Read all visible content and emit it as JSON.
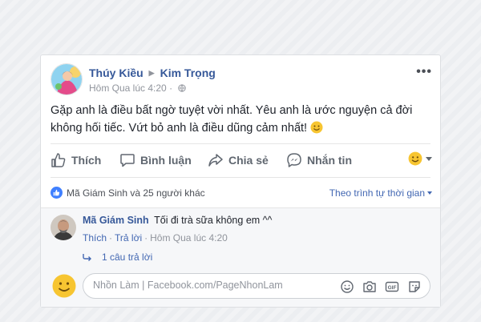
{
  "post": {
    "author": "Thúy Kiều",
    "recipient": "Kim Trọng",
    "timestamp": "Hôm Qua lúc 4:20",
    "text": "Gặp anh là điều bất ngờ tuyệt vời nhất. Yêu anh là ước nguyện cả đời không hối tiếc. Vứt bỏ anh là điều dũng cảm nhất!",
    "more_label": "•••"
  },
  "actions": {
    "like": "Thích",
    "comment": "Bình luận",
    "share": "Chia sẻ",
    "message": "Nhắn tin"
  },
  "likes": {
    "summary": "Mã Giám Sinh và 25 người khác",
    "sort_label": "Theo trình tự thời gian"
  },
  "comment": {
    "author": "Mã Giám Sinh",
    "text": "Tối đi trà sữa không em ^^",
    "like_label": "Thích",
    "reply_label": "Trả lời",
    "time": "Hôm Qua lúc 4:20",
    "replies_label": "1 câu trả lời"
  },
  "composer": {
    "placeholder": "Nhồn Làm | Facebook.com/PageNhonLam"
  },
  "colors": {
    "link": "#365899",
    "accent": "#4267b2",
    "muted": "#90949c",
    "like_badge": "#4080ff"
  }
}
